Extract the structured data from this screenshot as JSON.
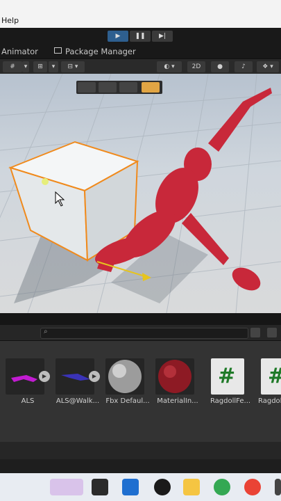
{
  "menu": {
    "help": "Help"
  },
  "playmode": {
    "play": "▶",
    "pause": "❚❚",
    "step": "▶|"
  },
  "tabs": {
    "animator": "Animator",
    "package_manager": "Package Manager"
  },
  "scene_toolbar": {
    "mode_2d": "2D"
  },
  "search": {
    "placeholder": ""
  },
  "assets": [
    {
      "label": "ALS",
      "icon": "prefab-icon"
    },
    {
      "label": "ALS@Walk...",
      "icon": "anim-icon"
    },
    {
      "label": "Fbx Defaul...",
      "icon": "material-icon"
    },
    {
      "label": "MaterialIn...",
      "icon": "material-icon"
    },
    {
      "label": "RagdollFe...",
      "icon": "script-icon"
    },
    {
      "label": "Ragdoll",
      "icon": "script-icon"
    }
  ],
  "colors": {
    "accent": "#2e5f8f",
    "selection": "#e1a544",
    "ragdoll": "#c8283a",
    "cube_outline": "#f08a1c"
  }
}
